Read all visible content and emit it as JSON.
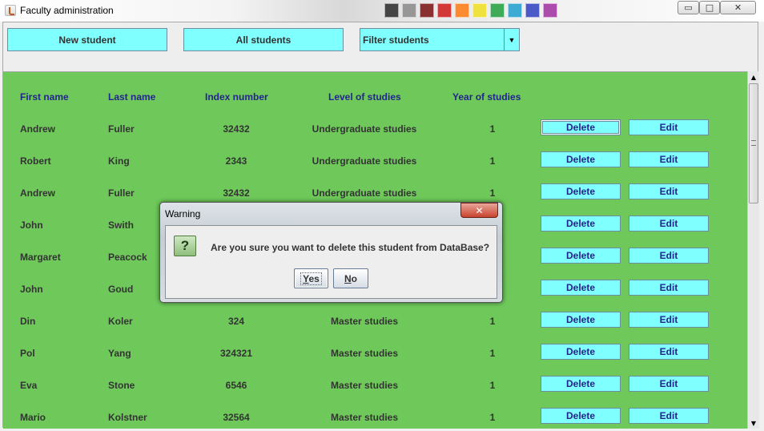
{
  "window": {
    "title": "Faculty administration",
    "minimize_glyph": "▭",
    "maximize_glyph": "□",
    "close_glyph": "✕"
  },
  "toolbar": {
    "new_student": "New student",
    "all_students": "All students",
    "filter": "Filter students",
    "filter_arrow": "▼"
  },
  "table": {
    "headers": [
      "First name",
      "Last name",
      "Index number",
      "Level of studies",
      "Year of studies"
    ],
    "rows": [
      {
        "first": "Andrew",
        "last": "Fuller",
        "index": "32432",
        "level": "Undergraduate studies",
        "year": "1"
      },
      {
        "first": "Robert",
        "last": "King",
        "index": "2343",
        "level": "Undergraduate studies",
        "year": "1"
      },
      {
        "first": "Andrew",
        "last": "Fuller",
        "index": "32432",
        "level": "Undergraduate studies",
        "year": "1"
      },
      {
        "first": "John",
        "last": "Swith",
        "index": "",
        "level": "",
        "year": ""
      },
      {
        "first": "Margaret",
        "last": "Peacock",
        "index": "",
        "level": "",
        "year": ""
      },
      {
        "first": "John",
        "last": "Goud",
        "index": "",
        "level": "",
        "year": ""
      },
      {
        "first": "Din",
        "last": "Koler",
        "index": "324",
        "level": "Master studies",
        "year": "1"
      },
      {
        "first": "Pol",
        "last": "Yang",
        "index": "324321",
        "level": "Master studies",
        "year": "1"
      },
      {
        "first": "Eva",
        "last": "Stone",
        "index": "6546",
        "level": "Master studies",
        "year": "1"
      },
      {
        "first": "Mario",
        "last": "Kolstner",
        "index": "32564",
        "level": "Master studies",
        "year": "1"
      }
    ],
    "delete_label": "Delete",
    "edit_label": "Edit"
  },
  "scrollbar": {
    "up": "▲",
    "down": "▼"
  },
  "dialog": {
    "title": "Warning",
    "close_glyph": "✕",
    "icon_glyph": "?",
    "message": "Are you sure you want to delete this student from DataBase?",
    "yes": "Yes",
    "no": "No"
  },
  "colors": {
    "panel": "#6ec95a",
    "button": "#80ffff",
    "header_text": "#24248e"
  }
}
